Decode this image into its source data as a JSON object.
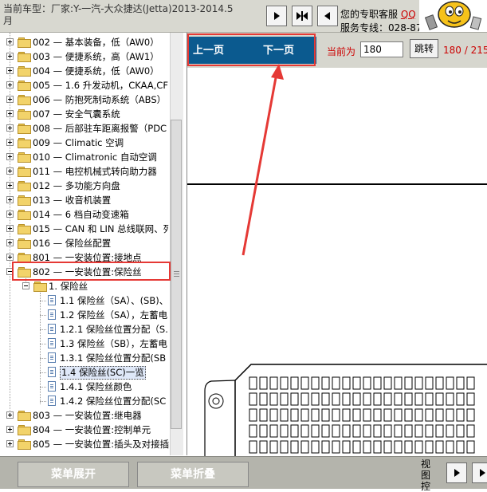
{
  "header": {
    "car_label": "当前车型：厂家:Y-一汽-大众捷达(Jetta)2013-2014.5月",
    "service_line1": "您的专职客服",
    "service_qq": "QQ",
    "service_line2": "服务专线：028-87"
  },
  "tree": {
    "items": [
      {
        "label": "002 — 基本装备，低（AW0）"
      },
      {
        "label": "003 — 便捷系统，高（AW1）"
      },
      {
        "label": "004 — 便捷系统，低（AW0）"
      },
      {
        "label": "005 — 1.6 升发动机，CKAA,CF"
      },
      {
        "label": "006 — 防抱死制动系统（ABS）"
      },
      {
        "label": "007 — 安全气囊系统"
      },
      {
        "label": "008 — 后部驻车距离报警（PDC"
      },
      {
        "label": "009 — Climatic 空调"
      },
      {
        "label": "010 — Climatronic 自动空调"
      },
      {
        "label": "011 — 电控机械式转向助力器"
      },
      {
        "label": "012 — 多功能方向盘"
      },
      {
        "label": "013 — 收音机装置"
      },
      {
        "label": "014 — 6 档自动变速箱"
      },
      {
        "label": "015 — CAN 和 LIN 总线联网、列"
      },
      {
        "label": "016 — 保险丝配置"
      },
      {
        "label": "801 — 一安装位置:接地点"
      },
      {
        "label": "802 — 一安装位置:保险丝"
      },
      {
        "label": "1. 保险丝"
      },
      {
        "label": "1.1 保险丝（SA）、(SB)、"
      },
      {
        "label": "1.2 保险丝（SA），左蓄电"
      },
      {
        "label": "1.2.1 保险丝位置分配（S."
      },
      {
        "label": "1.3 保险丝（SB），左蓄电"
      },
      {
        "label": "1.3.1 保险丝位置分配(SB"
      },
      {
        "label": "1.4 保险丝(SC)一览"
      },
      {
        "label": "1.4.1 保险丝颜色"
      },
      {
        "label": "1.4.2 保险丝位置分配(SC"
      },
      {
        "label": "803 — 一安装位置:继电器"
      },
      {
        "label": "804 — 一安装位置:控制单元"
      },
      {
        "label": "805 — 一安装位置:插头及对接插"
      }
    ]
  },
  "viewer": {
    "prev_label": "上一页",
    "next_label": "下一页",
    "current_label": "当前为",
    "page_value": "180",
    "jump_label": "跳转",
    "page_count": "180 / 215"
  },
  "footer": {
    "expand_label": "菜单展开",
    "collapse_label": "菜单折叠",
    "view_ctrl_label": "视图控"
  },
  "colors": {
    "nav_blue": "#0b5a8f",
    "annotation_red": "#e53935",
    "page_red": "#cc0000"
  }
}
